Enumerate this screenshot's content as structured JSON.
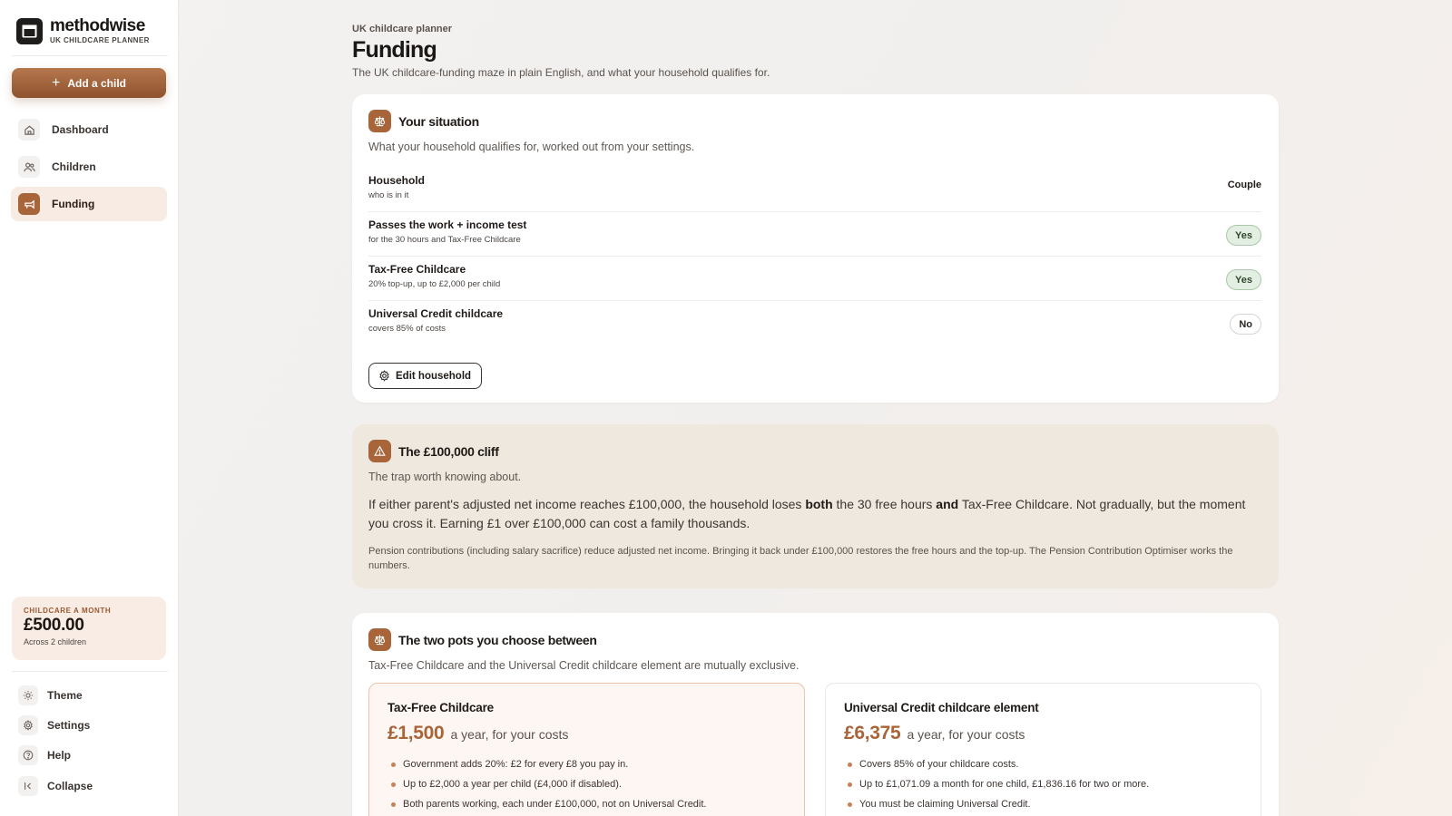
{
  "brand": {
    "name": "methodwise",
    "subtitle": "UK CHILDCARE PLANNER"
  },
  "sidebar": {
    "add_button": "Add a child",
    "nav": [
      {
        "label": "Dashboard",
        "icon": "home-icon",
        "active": false
      },
      {
        "label": "Children",
        "icon": "users-icon",
        "active": false
      },
      {
        "label": "Funding",
        "icon": "funding-icon",
        "active": true
      }
    ],
    "summary": {
      "kicker": "CHILDCARE A MONTH",
      "amount": "£500.00",
      "note": "Across 2 children"
    },
    "footer": [
      {
        "label": "Theme",
        "icon": "sun-icon"
      },
      {
        "label": "Settings",
        "icon": "gear-icon"
      },
      {
        "label": "Help",
        "icon": "help-icon"
      },
      {
        "label": "Collapse",
        "icon": "collapse-icon"
      }
    ]
  },
  "header": {
    "kicker": "UK childcare planner",
    "title": "Funding",
    "subtitle": "The UK childcare-funding maze in plain English, and what your household qualifies for."
  },
  "situation": {
    "title": "Your situation",
    "subtitle": "What your household qualifies for, worked out from your settings.",
    "rows": [
      {
        "label": "Household",
        "hint": "who is in it",
        "value": "Couple"
      },
      {
        "label": "Passes the work + income test",
        "hint": "for the 30 hours and Tax-Free Childcare",
        "value": "Yes"
      },
      {
        "label": "Tax-Free Childcare",
        "hint": "20% top-up, up to £2,000 per child",
        "value": "Yes"
      },
      {
        "label": "Universal Credit childcare",
        "hint": "covers 85% of costs",
        "value": "No"
      }
    ],
    "edit_button": "Edit household"
  },
  "cliff": {
    "title": "The £100,000 cliff",
    "subtitle": "The trap worth knowing about.",
    "body_1": "If either parent's adjusted net income reaches £100,000, the household loses ",
    "body_bold_1": "both",
    "body_2": " the 30 free hours ",
    "body_bold_2": "and",
    "body_3": " Tax-Free Childcare. Not gradually, but the moment you cross it. Earning £1 over £100,000 can cost a family thousands.",
    "note": "Pension contributions (including salary sacrifice) reduce adjusted net income. Bringing it back under £100,000 restores the free hours and the top-up. The Pension Contribution Optimiser works the numbers."
  },
  "pots": {
    "title": "The two pots you choose between",
    "subtitle": "Tax-Free Childcare and the Universal Credit childcare element are mutually exclusive.",
    "items": [
      {
        "title": "Tax-Free Childcare",
        "amount": "£1,500",
        "per": "a year, for your costs",
        "bullets": [
          "Government adds 20%: £2 for every £8 you pay in.",
          "Up to £2,000 a year per child (£4,000 if disabled).",
          "Both parents working, each under £100,000, not on Universal Credit."
        ]
      },
      {
        "title": "Universal Credit childcare element",
        "amount": "£6,375",
        "per": "a year, for your costs",
        "bullets": [
          "Covers 85% of your childcare costs.",
          "Up to £1,071.09 a month for one child, £1,836.16 for two or more.",
          "You must be claiming Universal Credit."
        ]
      }
    ]
  },
  "colors": {
    "accent": "#a8653a",
    "yes_bg": "#e4efe4",
    "cliff_bg": "#efe8de"
  }
}
